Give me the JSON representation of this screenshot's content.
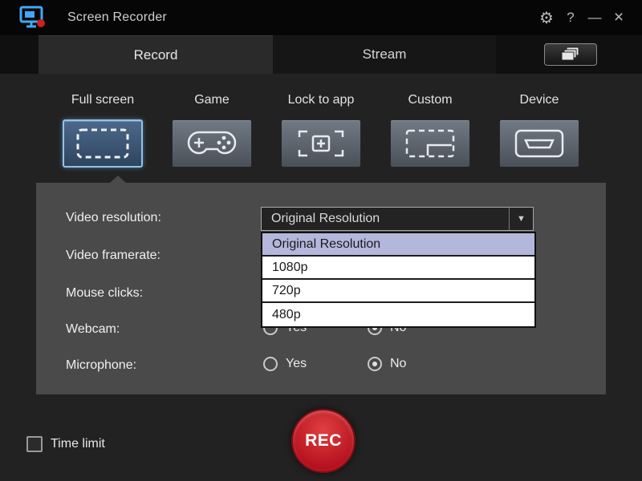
{
  "titlebar": {
    "title": "Screen Recorder"
  },
  "icons": {
    "app_logo": "monitor-with-record-dot",
    "gear_glyph": "⚙",
    "help_glyph": "?",
    "minimize_glyph": "—",
    "close_glyph": "×",
    "dropdown_arrow_glyph": "▼",
    "pip_button": "stacked-windows",
    "mode_icons": [
      "dashed-fullscreen",
      "gamepad",
      "lock-to-app-brackets",
      "custom-region",
      "device-connector"
    ]
  },
  "tabs": {
    "record": "Record",
    "stream": "Stream"
  },
  "modes": [
    {
      "label": "Full screen",
      "selected": true
    },
    {
      "label": "Game",
      "selected": false
    },
    {
      "label": "Lock to app",
      "selected": false
    },
    {
      "label": "Custom",
      "selected": false
    },
    {
      "label": "Device",
      "selected": false
    }
  ],
  "settings": {
    "labels": [
      "Video resolution:",
      "Video framerate:",
      "Mouse clicks:",
      "Webcam:",
      "Microphone:"
    ],
    "resolution_dropdown": {
      "value": "Original Resolution",
      "options": [
        "Original Resolution",
        "1080p",
        "720p",
        "480p"
      ],
      "highlighted_option": "Original Resolution",
      "expanded": true
    },
    "webcam": {
      "yes_label": "Yes",
      "no_label": "No",
      "selected": "No"
    },
    "microphone": {
      "yes_label": "Yes",
      "no_label": "No",
      "selected": "No"
    }
  },
  "footer": {
    "time_limit_label": "Time limit",
    "time_limit_checked": false,
    "rec_label": "REC"
  },
  "colors": {
    "accent_red": "#b5121f",
    "selected_blue": "#8fc3ec",
    "panel_gray": "#4a4a4a",
    "dropdown_highlight": "#b4b7dc"
  }
}
